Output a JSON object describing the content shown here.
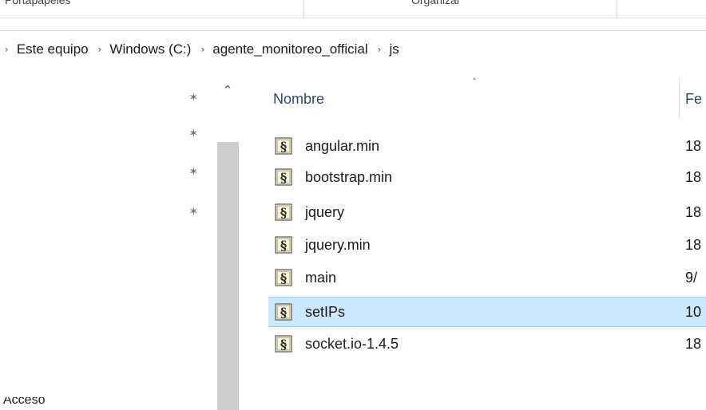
{
  "ribbon": {
    "groups": [
      "Portapapeles",
      "Organizar"
    ]
  },
  "address_bar": {
    "crumbs": [
      "Este equipo",
      "Windows (C:)",
      "agente_monitoreo_official",
      "js"
    ]
  },
  "nav_pane": {
    "bottom_text": "Acceso"
  },
  "file_list": {
    "columns": {
      "name": "Nombre",
      "date": "Fe"
    },
    "items": [
      {
        "name": "angular.min",
        "date": "18"
      },
      {
        "name": "bootstrap.min",
        "date": "18"
      },
      {
        "name": "jquery",
        "date": "18"
      },
      {
        "name": "jquery.min",
        "date": "18"
      },
      {
        "name": "main",
        "date": "9/"
      },
      {
        "name": "setIPs",
        "date": "10",
        "selected": true
      },
      {
        "name": "socket.io-1.4.5",
        "date": "18"
      }
    ]
  },
  "icons": {
    "pin": "pin-icon",
    "file": "js-script-file-icon",
    "chevron": "chevron-right-icon",
    "sort": "sort-ascending-icon",
    "scroll_up": "scroll-up-arrow-icon"
  },
  "colors": {
    "selection_bg": "#cce8ff",
    "selection_border": "#99d1ff",
    "header_text": "#2c4a6e",
    "scroll_thumb": "#cdcdcd"
  }
}
